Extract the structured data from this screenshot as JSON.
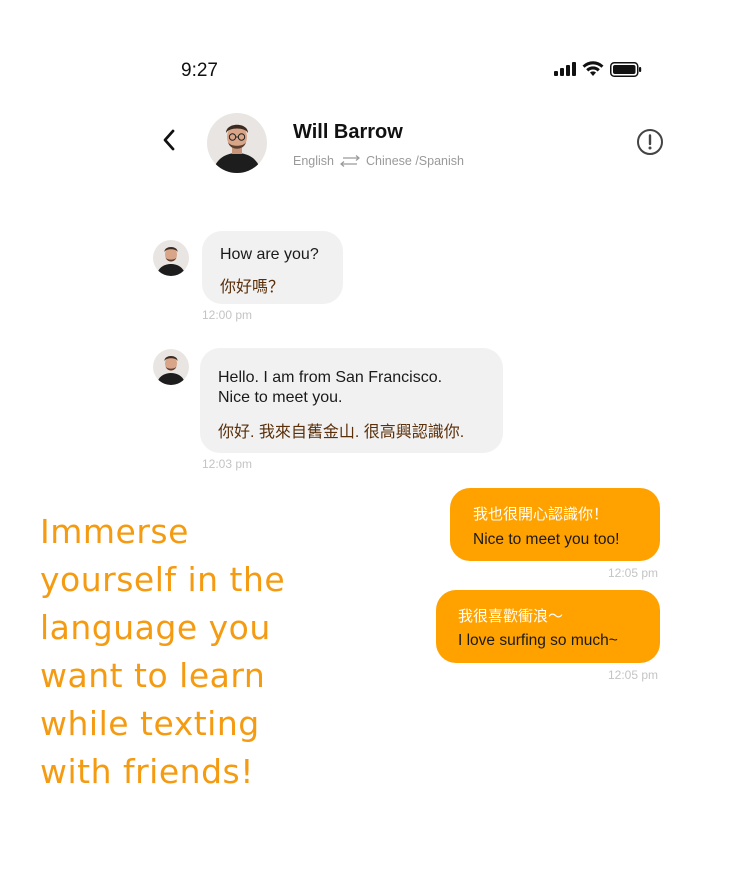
{
  "status_bar": {
    "time": "9:27"
  },
  "header": {
    "contact_name": "Will Barrow",
    "lang_from": "English",
    "lang_to": "Chinese /Spanish"
  },
  "messages": [
    {
      "direction": "incoming",
      "en": "How are you?",
      "zh": "你好嗎？",
      "time": "12:00 pm"
    },
    {
      "direction": "incoming",
      "en_line1": "Hello. I am from San Francisco.",
      "en_line2": "Nice to meet you.",
      "zh": "你好. 我來自舊金山. 很高興認識你.",
      "time": "12:03 pm"
    },
    {
      "direction": "outgoing",
      "zh": "我也很開心認識你！",
      "en": "Nice to meet you too!",
      "time": "12:05 pm"
    },
    {
      "direction": "outgoing",
      "zh": "我很喜歡衝浪～",
      "en": "I love surfing so much~",
      "time": "12:05 pm"
    }
  ],
  "tagline": {
    "lines": [
      "Immerse",
      "yourself in the",
      "language you",
      "want to learn",
      "while texting",
      "with friends!"
    ]
  },
  "colors": {
    "accent": "#ffa200",
    "tagline": "#f59b12",
    "incoming_bubble": "#f1f1f1"
  },
  "icons": [
    "back-chevron-icon",
    "info-icon",
    "signal-icon",
    "wifi-icon",
    "battery-icon",
    "swap-arrows-icon"
  ]
}
